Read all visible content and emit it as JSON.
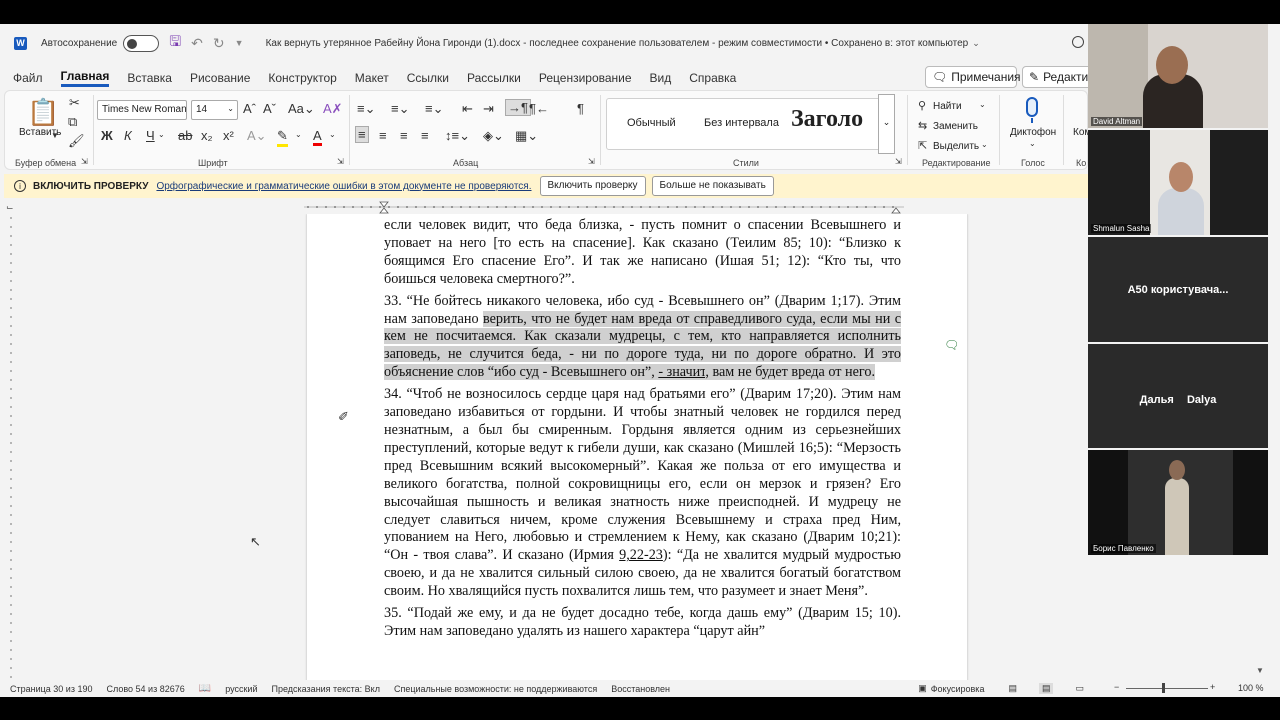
{
  "titlebar": {
    "autosave_label": "Автосохранение",
    "doc_title": "Как вернуть утерянное Рабейну Йона Гиронди (1).docx  -  последнее сохранение пользователем  -  режим совместимости • Сохранено в: этот компьютер"
  },
  "tabs": [
    "Файл",
    "Главная",
    "Вставка",
    "Рисование",
    "Конструктор",
    "Макет",
    "Ссылки",
    "Рассылки",
    "Рецензирование",
    "Вид",
    "Справка"
  ],
  "tab_buttons": {
    "comments": "Примечания",
    "edit": "Редактир"
  },
  "ribbon": {
    "paste": "Вставить",
    "font_name": "Times New Roman",
    "font_size": "14",
    "groups": {
      "clipboard": "Буфер обмена",
      "font": "Шрифт",
      "paragraph": "Абзац",
      "styles": "Стили",
      "editing": "Редактирование",
      "voice": "Голос",
      "comments": "Ко"
    },
    "styles": {
      "normal": "Обычный",
      "no_spacing": "Без интервала",
      "heading": "Заголо"
    },
    "editing": {
      "find": "Найти",
      "replace": "Заменить",
      "select": "Выделить"
    },
    "voice": {
      "dictate": "Диктофон"
    },
    "comment_short": "Ком"
  },
  "infobar": {
    "title": "ВКЛЮЧИТЬ ПРОВЕРКУ",
    "message": "Орфографические и грамматические ошибки в этом документе не проверяются.",
    "btn_enable": "Включить проверку",
    "btn_dismiss": "Больше не показывать"
  },
  "document": {
    "p1": "если человек видит, что беда близка, - пусть помнит о спасении Всевышнего и уповает на него [то есть на спасение]. Как сказано (Теилим 85; 10): “Близко к боящимся Его спасение Его”. И так же написано (Ишая 51; 12): “Кто ты, что боишься человека смертного?”.",
    "p2a": "33.    “Не бойтесь никакого человека, ибо суд - Всевышнего он” (Дварим 1;17). Этим нам заповедано ",
    "p2b": "верить, что не будет нам вреда от справедливого суда, если мы ни с кем не посчитаемся. Как сказали мудрецы, с тем, кто направляется исполнить заповедь, не случится беда, - ни по дороге туда, ни по дороге обратно. И это объяснение слов “ибо суд - Всевышнего он”, ",
    "p2c": "- значит",
    "p2d": ", вам не будет вреда от него.",
    "p3a": "34.    “Чтоб не возносилось сердце царя над братьями его” (Дварим 17;20). Этим нам заповедано избавиться от гордыни. И чтобы знатный человек не гордился перед незнатным, а был бы смиренным. Гордыня является одним из серьезнейших преступлений, которые ведут к гибели души, как сказано (Мишлей 16;5): “Мерзость пред Всевышним всякий высокомерный”. Какая же польза от его имущества и великого богатства, полной сокровищницы его, если он мерзок и грязен? Его высочайшая пышность и великая знатность ниже преисподней. И мудрецу не следует славиться ничем, кроме служения Всевышнему и страха пред Ним, упованием на Него, любовью и стремлением к Нему, как сказано (Дварим 10;21): “Он - твоя слава”. И сказано (Ирмия ",
    "p3b": "9,22-23",
    "p3c": "): “Да не хвалится мудрый мудростью своею, и да не хвалится сильный силою своею, да не хвалится богатый богатством своим. Но хвалящийся пусть похвалится лишь тем, что разумеет и знает Меня”.",
    "p4": "35.    “Подай же ему, и да не будет досадно тебе, когда дашь ему” (Дварим 15; 10). Этим нам заповедано удалять из нашего характера “царут айн”"
  },
  "statusbar": {
    "page": "Страница 30 из 190",
    "words": "Слово 54 из 82676",
    "lang": "русский",
    "predict": "Предсказания текста: Вкл",
    "access": "Специальные возможности: не поддерживаются",
    "restored": "Восстановлен",
    "focus": "Фокусировка",
    "zoom": "100 %"
  },
  "participants": [
    {
      "name": "David Altman"
    },
    {
      "name": "Shmalun Sasha"
    },
    {
      "name": "A50  користувача..."
    },
    {
      "name": "Дальяᅠ Dalya"
    },
    {
      "name": "Борис Павленко"
    }
  ]
}
